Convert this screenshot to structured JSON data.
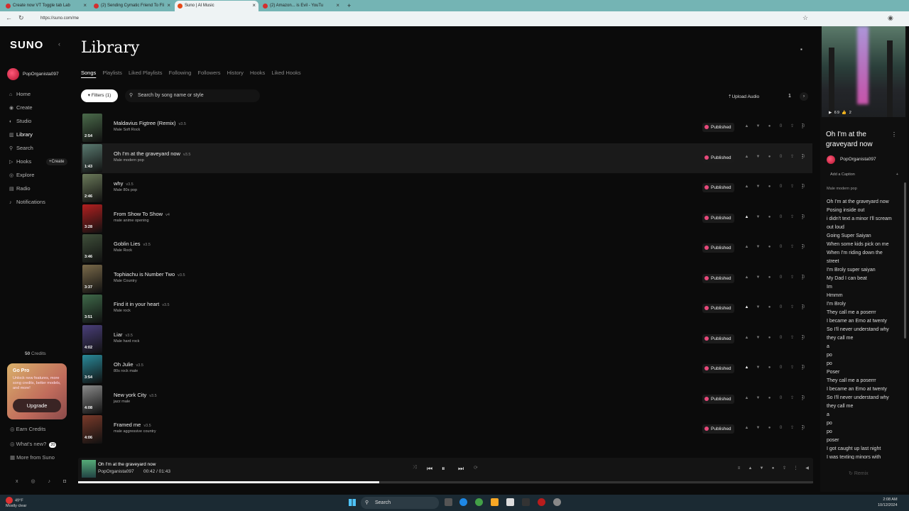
{
  "browser": {
    "tabs": [
      {
        "label": "Create now VT Toggle tab Lab",
        "color": "#d32f2f"
      },
      {
        "label": "(2) Sending Cymatic Friend To Fli",
        "color": "#d32f2f"
      },
      {
        "label": "Suno | AI Music",
        "color": "#d32f2f"
      },
      {
        "label": "(2) Amazon... is Evil - YouTu",
        "color": "#d32f2f"
      }
    ],
    "url": "https://suno.com/me"
  },
  "sidebar": {
    "logo": "SUNO",
    "username": "PopOrganista097",
    "nav": [
      {
        "label": "Home",
        "icon": "home-icon",
        "glyph": "⌂"
      },
      {
        "label": "Create",
        "icon": "create-icon",
        "glyph": "◉"
      },
      {
        "label": "Studio",
        "icon": "studio-icon",
        "glyph": "◐"
      },
      {
        "label": "Library",
        "icon": "library-icon",
        "glyph": "▥"
      },
      {
        "label": "Search",
        "icon": "search-icon",
        "glyph": "⚲"
      },
      {
        "label": "Hooks",
        "icon": "hooks-icon",
        "glyph": "▷"
      },
      {
        "label": "Explore",
        "icon": "explore-icon",
        "glyph": "◎"
      },
      {
        "label": "Radio",
        "icon": "radio-icon",
        "glyph": "▤"
      },
      {
        "label": "Notifications",
        "icon": "bell-icon",
        "glyph": "♪"
      }
    ],
    "create_pill": "+Create",
    "credits_count": "50",
    "credits_label": "Credits",
    "gopro_title": "Go Pro",
    "gopro_desc": "Unlock new features, more song credits, better models, and more!",
    "upgrade_label": "Upgrade",
    "earn_credits": "Earn Credits",
    "whats_new": "What's new?",
    "whats_new_badge": "20",
    "more_from_suno": "More from Suno",
    "social": "x ◎ ♪ ◘"
  },
  "main": {
    "title": "Library",
    "tabs": [
      "Songs",
      "Playlists",
      "Liked Playlists",
      "Following",
      "Followers",
      "History",
      "Hooks",
      "Liked Hooks"
    ],
    "filters_label": "Filters (1)",
    "search_placeholder": "Search by song name or style",
    "upload_label": "Upload Audio",
    "page_number": "1",
    "published_label": "Published",
    "zero": "0",
    "songs": [
      {
        "title": "Maldavius Figtree (Remix)",
        "version": "v3.5",
        "style": "Male Soft Rock",
        "duration": "2:54",
        "liked": false,
        "thumb": "#4b6b4b"
      },
      {
        "title": "Oh I'm at the graveyard now",
        "version": "v3.5",
        "style": "Male modern pop",
        "duration": "1:43",
        "liked": false,
        "thumb": "#5a7a70"
      },
      {
        "title": "why",
        "version": "v3.5",
        "style": "Male 80s pop",
        "duration": "2:46",
        "liked": false,
        "thumb": "#6b7a5a"
      },
      {
        "title": "From Show To Show",
        "version": "v4",
        "style": "male anime opening",
        "duration": "3:28",
        "liked": true,
        "thumb": "#b32020"
      },
      {
        "title": "Goblin Lies",
        "version": "v3.5",
        "style": "Male Rock",
        "duration": "3:46",
        "liked": false,
        "thumb": "#3f4f3a"
      },
      {
        "title": "Tophiachu is Number Two",
        "version": "v3.5",
        "style": "Male Country",
        "duration": "3:37",
        "liked": false,
        "thumb": "#7a6a4a"
      },
      {
        "title": "Find it in your heart",
        "version": "v3.5",
        "style": "Male rock",
        "duration": "3:51",
        "liked": true,
        "thumb": "#3f6a4a"
      },
      {
        "title": "Liar",
        "version": "v3.5",
        "style": "Male hard rock",
        "duration": "4:02",
        "liked": false,
        "thumb": "#4a3f7a"
      },
      {
        "title": "Oh Julie",
        "version": "v3.5",
        "style": "80s rock male",
        "duration": "3:54",
        "liked": true,
        "thumb": "#2a8a9a"
      },
      {
        "title": "New york City",
        "version": "v3.5",
        "style": "jazz male",
        "duration": "4:08",
        "liked": false,
        "thumb": "#8a8a8a"
      },
      {
        "title": "Framed me",
        "version": "v3.5",
        "style": "male aggressive country",
        "duration": "4:06",
        "liked": false,
        "thumb": "#7a3a2a"
      }
    ]
  },
  "player": {
    "title": "Oh I'm at the graveyard now",
    "artist": "PopOrganista097",
    "time": "00:42 / 01:43",
    "progress": 0.41
  },
  "right": {
    "stats": "▶ 69 👍 2",
    "title": "Oh I'm at the graveyard now",
    "username": "PopOrganista097",
    "caption_label": "Add a Caption",
    "style": "Male modern pop",
    "lyrics": [
      "Oh I'm at the graveyard now",
      "Posing inside out",
      "i didn't text a minor I'll scream",
      "out loud",
      "Going Super Saiyan",
      "When some kids pick on me",
      "When I'm riding down the",
      "street",
      "I'm Broly super saiyan",
      "My Dad I can beat",
      "Im",
      "Hmmm",
      "I'm Broly",
      "They call me a poserrr",
      "I became an Emo at twenty",
      "So I'll never understand why",
      "they call me",
      "a",
      "po",
      "po",
      "Poser",
      "They call me a poserrr",
      "I became an Emo at twenty",
      "So I'll never understand why",
      "they call me",
      "a",
      "po",
      "po",
      "poser",
      "I got caught up last night",
      "I was texting minors with"
    ],
    "remix_label": "Remix"
  },
  "taskbar": {
    "temp": "49°F",
    "weather": "Mostly clear",
    "search": "Search",
    "time": "2:08 AM",
    "date": "10/12/2024"
  }
}
